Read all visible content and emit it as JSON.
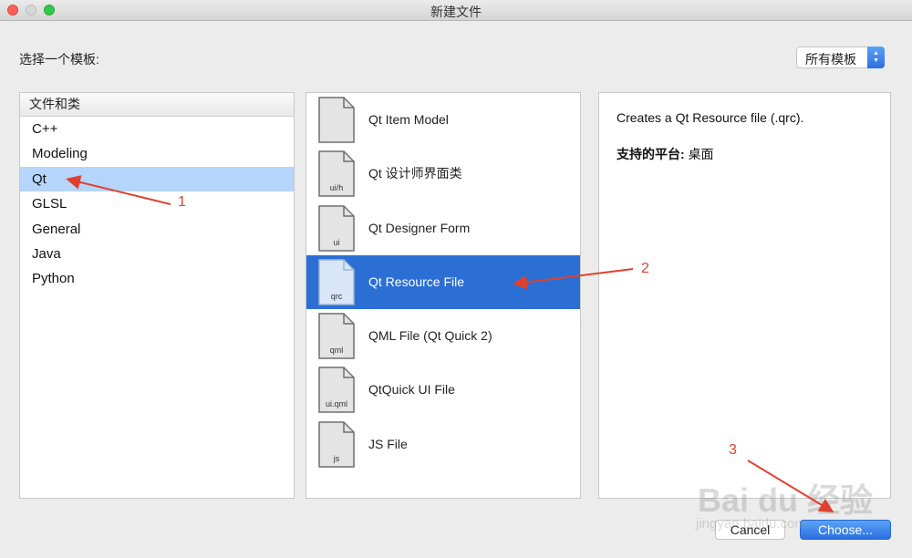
{
  "window": {
    "title": "新建文件"
  },
  "prompt": "选择一个模板:",
  "filter": {
    "selected": "所有模板"
  },
  "categories": {
    "header": "文件和类",
    "items": [
      "C++",
      "Modeling",
      "Qt",
      "GLSL",
      "General",
      "Java",
      "Python"
    ],
    "selected_index": 2
  },
  "templates": {
    "items": [
      {
        "label": "Qt Item Model",
        "icon_text": ""
      },
      {
        "label": "Qt 设计师界面类",
        "icon_text": "ui/h"
      },
      {
        "label": "Qt Designer Form",
        "icon_text": "ui"
      },
      {
        "label": "Qt Resource File",
        "icon_text": "qrc"
      },
      {
        "label": "QML File (Qt Quick 2)",
        "icon_text": "qml"
      },
      {
        "label": "QtQuick UI File",
        "icon_text": "ui.qml"
      },
      {
        "label": "JS File",
        "icon_text": "js"
      }
    ],
    "selected_index": 3
  },
  "details": {
    "description": "Creates a Qt Resource file (.qrc).",
    "platform_label": "支持的平台:",
    "platform_value": "桌面"
  },
  "buttons": {
    "cancel": "Cancel",
    "choose": "Choose..."
  },
  "annotations": [
    "1",
    "2",
    "3"
  ],
  "watermark": {
    "main": "Bai du 经验",
    "sub": "jingyan.baidu.com"
  },
  "colors": {
    "selection_blue": "#2b6fd5",
    "selection_light": "#b5d5fc",
    "annotation_red": "#e0412f"
  }
}
